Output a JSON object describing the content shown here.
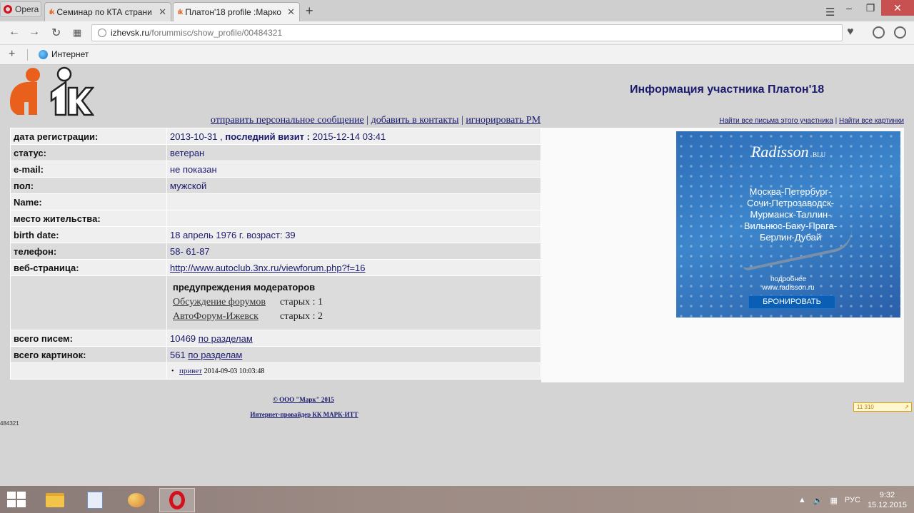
{
  "browser": {
    "menu_label": "Opera",
    "tabs": [
      {
        "label": "Семинар по КТА страни",
        "favicon": "ik-icon"
      },
      {
        "label": "Платон'18 profile :Марко",
        "favicon": "ik-icon"
      }
    ],
    "url_domain": "izhevsk.ru",
    "url_path": "/forummisc/show_profile/00484321",
    "bookmark_label": "Интернет"
  },
  "page": {
    "title": "Информация участника Платон'18",
    "actions": {
      "send_pm": "отправить персональное сообщение",
      "add_contact": "добавить в контакты",
      "ignore_pm": "игнорировать PM",
      "sep": "|"
    },
    "search_links": {
      "find_posts": "Найти все письма этого участника",
      "find_images": "Найти все картинки",
      "sep": "|"
    },
    "profile": {
      "reg_label": "дата регистрации:",
      "reg_date": "2013-10-31",
      "reg_sep": ",",
      "last_visit_label": "последний визит :",
      "last_visit": "2015-12-14 03:41",
      "status_label": "статус:",
      "status": "ветеран",
      "email_label": "e-mail:",
      "email": "не показан",
      "gender_label": "пол:",
      "gender": "мужской",
      "name_label": "Name:",
      "name": "",
      "residence_label": "место жительства:",
      "residence": "",
      "birth_label": "birth date:",
      "birth": "18 апрель 1976 г. возраст: 39",
      "phone_label": "телефон:",
      "phone": "58- 61-87",
      "web_label": "веб-страница:",
      "web": "http://www.autoclub.3nx.ru/viewforum.php?f=16",
      "warnings_title": "предупреждения модераторов",
      "warnings": [
        {
          "forum": "Обсуждение форумов",
          "count": "старых : 1"
        },
        {
          "forum": "АвтоФорум-Ижевск",
          "count": "старых : 2"
        }
      ],
      "posts_label": "всего писем:",
      "posts_count": "10469",
      "posts_link": "по разделам",
      "images_label": "всего картинок:",
      "images_count": "561",
      "images_link": "по разделам",
      "recent_title": "привет",
      "recent_date": "2014-09-03 10:03:48"
    },
    "ad": {
      "brand": "Radisson",
      "brand_suffix": "BLU",
      "routes": [
        "Москва-Петербург-",
        "Сочи-Петрозаводск-",
        "Мурманск-Таллин-",
        "Вильнюс-Баку-Прага-",
        "Берлин-Дубай"
      ],
      "more": "подробнее",
      "url": "www.radisson.ru",
      "button": "БРОНИРОВАТЬ"
    },
    "footer": {
      "copyright": "© ООО \"Марк\" 2015",
      "isp": "Интернет-провайдер КК МАРК-ИТТ",
      "counter": "484321",
      "badge": "11 310"
    }
  },
  "taskbar": {
    "lang": "РУС",
    "time": "9:32",
    "date": "15.12.2015"
  },
  "colors": {
    "link": "#1a1a6e",
    "logo_orange": "#e8601c",
    "opera_red": "#d40f1e"
  }
}
